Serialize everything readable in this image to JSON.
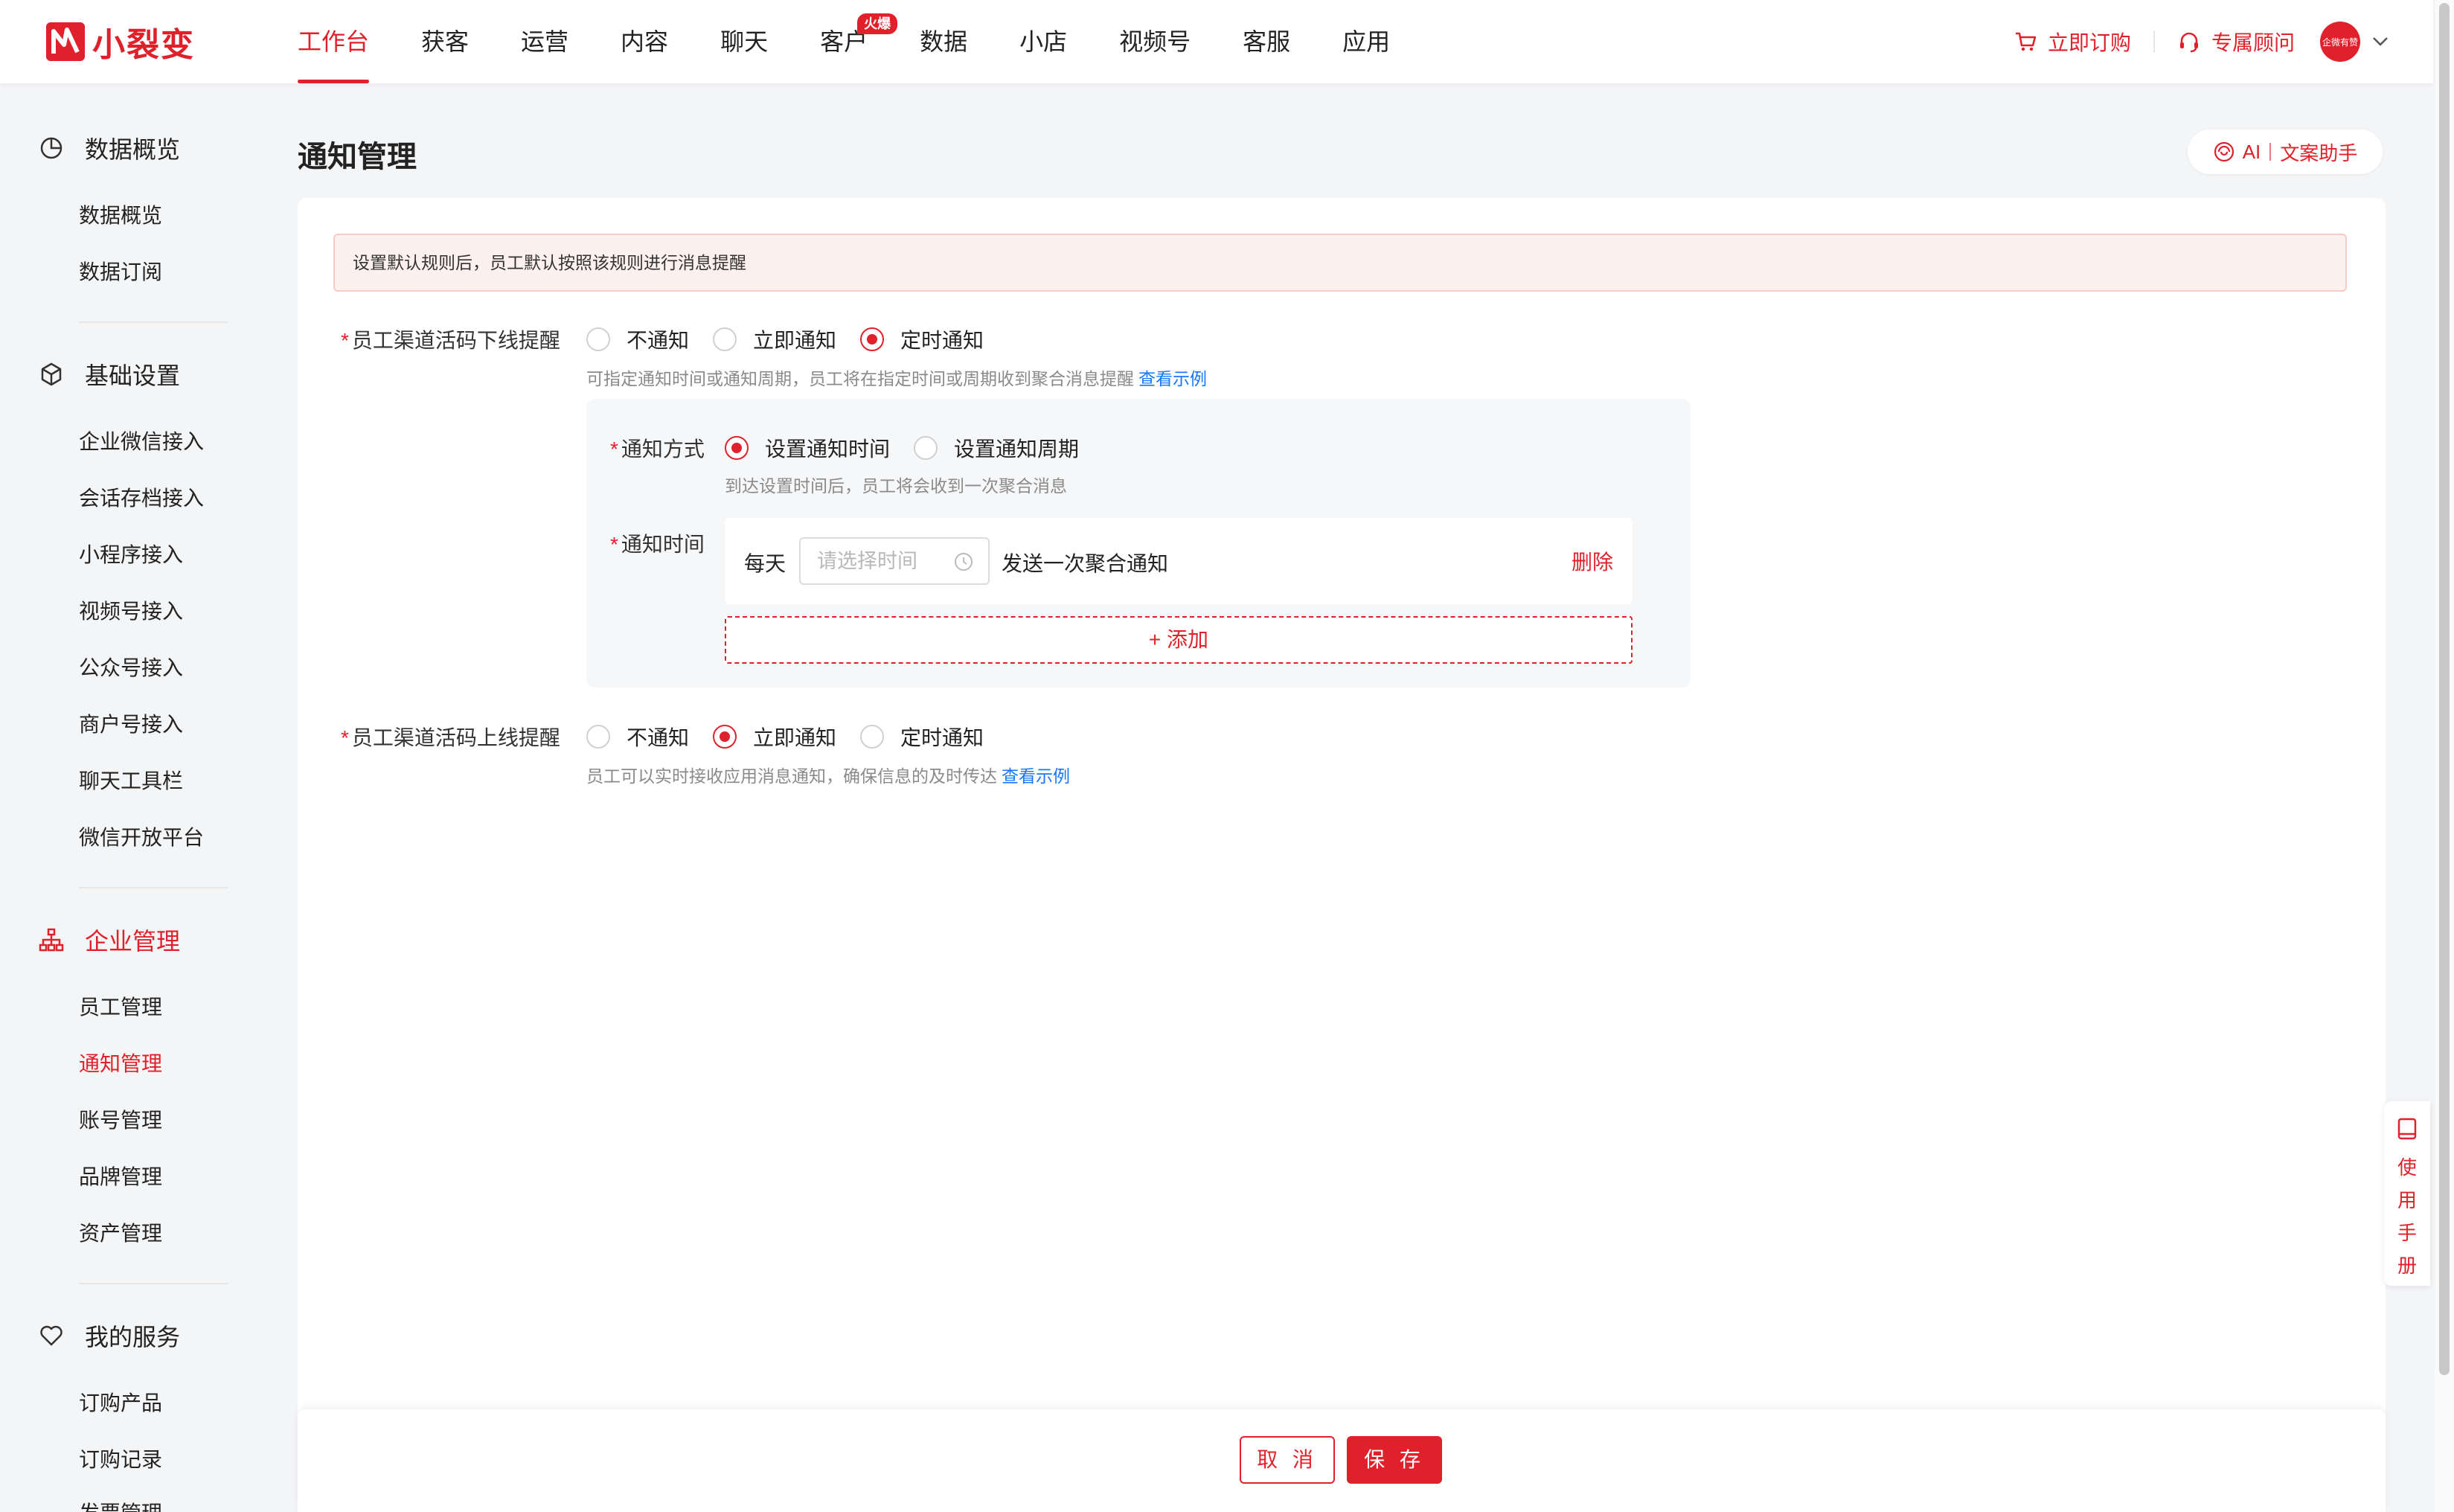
{
  "brand": {
    "name": "小裂变",
    "accent": "#e0212b"
  },
  "nav": {
    "items": [
      {
        "label": "工作台",
        "active": true
      },
      {
        "label": "获客"
      },
      {
        "label": "运营"
      },
      {
        "label": "内容"
      },
      {
        "label": "聊天"
      },
      {
        "label": "客户",
        "badge": "火爆"
      },
      {
        "label": "数据"
      },
      {
        "label": "小店"
      },
      {
        "label": "视频号"
      },
      {
        "label": "客服"
      },
      {
        "label": "应用"
      }
    ],
    "order_label": "立即订购",
    "advisor_label": "专属顾问",
    "avatar_text": "企微有赞"
  },
  "sidebar": {
    "groups": [
      {
        "label": "数据概览",
        "icon": "pie-chart-icon",
        "items": [
          "数据概览",
          "数据订阅"
        ]
      },
      {
        "label": "基础设置",
        "icon": "cube-icon",
        "items": [
          "企业微信接入",
          "会话存档接入",
          "小程序接入",
          "视频号接入",
          "公众号接入",
          "商户号接入",
          "聊天工具栏",
          "微信开放平台"
        ]
      },
      {
        "label": "企业管理",
        "icon": "org-chart-icon",
        "active": true,
        "items": [
          "员工管理",
          "通知管理",
          "账号管理",
          "品牌管理",
          "资产管理"
        ],
        "active_item": "通知管理"
      },
      {
        "label": "我的服务",
        "icon": "heart-icon",
        "items": [
          "订购产品",
          "订购记录",
          "发票管理"
        ]
      }
    ]
  },
  "page": {
    "title": "通知管理",
    "ai_label": "AI",
    "ai_sub": "文案助手",
    "alert": "设置默认规则后，员工默认按照该规则进行消息提醒",
    "offline": {
      "label": "员工渠道活码下线提醒",
      "options": [
        "不通知",
        "立即通知",
        "定时通知"
      ],
      "selected": "定时通知",
      "hint": "可指定通知时间或通知周期，员工将在指定时间或周期收到聚合消息提醒",
      "link": "查看示例"
    },
    "method": {
      "label": "通知方式",
      "options": [
        "设置通知时间",
        "设置通知周期"
      ],
      "selected": "设置通知时间",
      "hint": "到达设置时间后，员工将会收到一次聚合消息"
    },
    "time": {
      "label": "通知时间",
      "prefix": "每天",
      "placeholder": "请选择时间",
      "suffix": "发送一次聚合通知",
      "delete": "删除",
      "add": "+ 添加"
    },
    "online": {
      "label": "员工渠道活码上线提醒",
      "options": [
        "不通知",
        "立即通知",
        "定时通知"
      ],
      "selected": "立即通知",
      "hint": "员工可以实时接收应用消息通知，确保信息的及时传达",
      "link": "查看示例"
    }
  },
  "footer": {
    "cancel": "取 消",
    "save": "保 存"
  },
  "manual": {
    "label": "使用手册"
  }
}
